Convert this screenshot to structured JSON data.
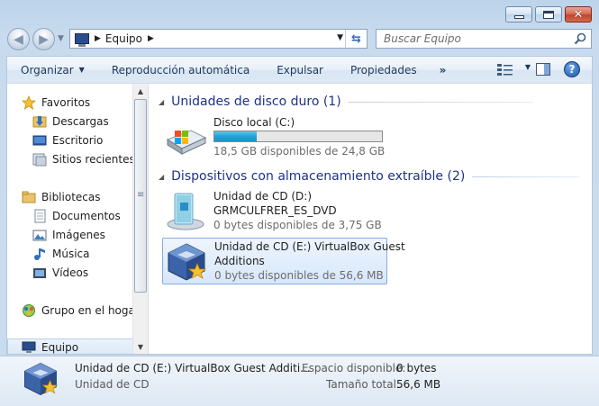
{
  "window": {
    "caption_buttons": [
      "minimize",
      "maximize",
      "close"
    ]
  },
  "address_bar": {
    "location": "Equipo",
    "icon": "computer-icon"
  },
  "search": {
    "placeholder": "Buscar Equipo"
  },
  "command_bar": {
    "organize": "Organizar",
    "autoplay": "Reproducción automática",
    "eject": "Expulsar",
    "properties": "Propiedades",
    "more": "»"
  },
  "nav_pane": {
    "favorites": "Favoritos",
    "downloads": "Descargas",
    "desktop": "Escritorio",
    "recent": "Sitios recientes",
    "libraries": "Bibliotecas",
    "documents": "Documentos",
    "pictures": "Imágenes",
    "music": "Música",
    "videos": "Vídeos",
    "homegroup": "Grupo en el hogar",
    "computer": "Equipo"
  },
  "groups": {
    "hard_disks": "Unidades de disco duro (1)",
    "removable": "Dispositivos con almacenamiento extraíble (2)"
  },
  "drives": {
    "c": {
      "name": "Disco local (C:)",
      "free_text": "18,5 GB disponibles de 24,8 GB",
      "used_fraction": 0.25
    },
    "d": {
      "name": "Unidad de CD (D:)",
      "label": "GRMCULFRER_ES_DVD",
      "free_text": "0 bytes disponibles de 3,75 GB"
    },
    "e": {
      "name_line1": "Unidad de CD (E:) VirtualBox Guest",
      "name_line2": "Additions",
      "free_text": "0 bytes disponibles de 56,6 MB"
    }
  },
  "details": {
    "name": "Unidad de CD (E:) VirtualBox Guest Additi...",
    "type": "Unidad de CD",
    "free_label": "Espacio disponible:",
    "free_value": "0 bytes",
    "total_label": "Tamaño total:",
    "total_value": "56,6 MB"
  }
}
